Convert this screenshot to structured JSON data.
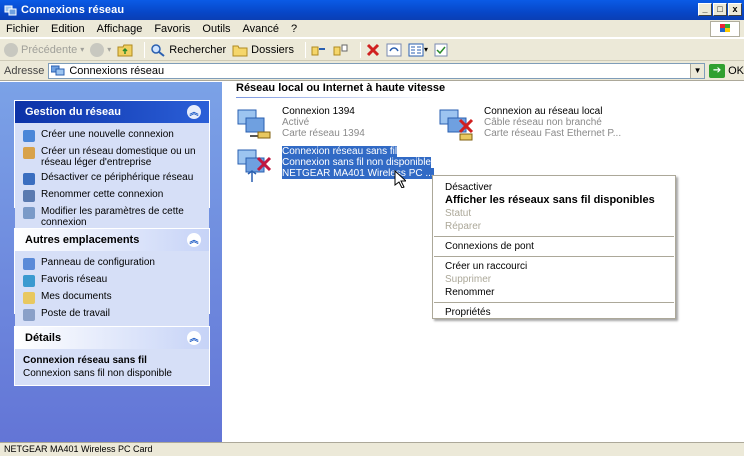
{
  "window": {
    "title": "Connexions réseau",
    "buttons": [
      "_",
      "□",
      "x"
    ]
  },
  "menubar": {
    "items": [
      "Fichier",
      "Edition",
      "Affichage",
      "Favoris",
      "Outils",
      "Avancé",
      "?"
    ]
  },
  "toolbar": {
    "back": "Précédente",
    "search": "Rechercher",
    "folders": "Dossiers"
  },
  "address": {
    "label": "Adresse",
    "value": "Connexions réseau",
    "go": "OK"
  },
  "left": {
    "network_tasks": {
      "title": "Gestion du réseau",
      "items": [
        "Créer une nouvelle connexion",
        "Créer un réseau domestique ou un réseau léger d'entreprise",
        "Désactiver ce périphérique réseau",
        "Renommer cette connexion",
        "Modifier les paramètres de cette connexion"
      ]
    },
    "other_places": {
      "title": "Autres emplacements",
      "items": [
        "Panneau de configuration",
        "Favoris réseau",
        "Mes documents",
        "Poste de travail"
      ]
    },
    "details": {
      "title": "Détails",
      "name": "Connexion réseau sans fil",
      "status": "Connexion sans fil non disponible"
    }
  },
  "content": {
    "group_title": "Réseau local ou Internet à haute vitesse",
    "connections": [
      {
        "name": "Connexion 1394",
        "status": "Activé",
        "device": "Carte réseau 1394"
      },
      {
        "name": "Connexion au réseau local",
        "status": "Câble réseau non branché",
        "device": "Carte réseau Fast Ethernet P..."
      },
      {
        "name": "Connexion réseau sans fil",
        "status": "Connexion sans fil non disponible",
        "device": "NETGEAR MA401 Wireless PC ..."
      }
    ]
  },
  "context_menu": {
    "disable": "Désactiver",
    "view_wireless": "Afficher les réseaux sans fil disponibles",
    "status": "Statut",
    "repair": "Réparer",
    "bridge": "Connexions de pont",
    "shortcut": "Créer un raccourci",
    "delete": "Supprimer",
    "rename": "Renommer",
    "properties": "Propriétés"
  },
  "statusbar": {
    "text": "NETGEAR MA401 Wireless PC Card"
  },
  "colors": {
    "titlebar": "#0a5be6",
    "selection": "#316ac5",
    "task_pane": "#6375d6"
  }
}
